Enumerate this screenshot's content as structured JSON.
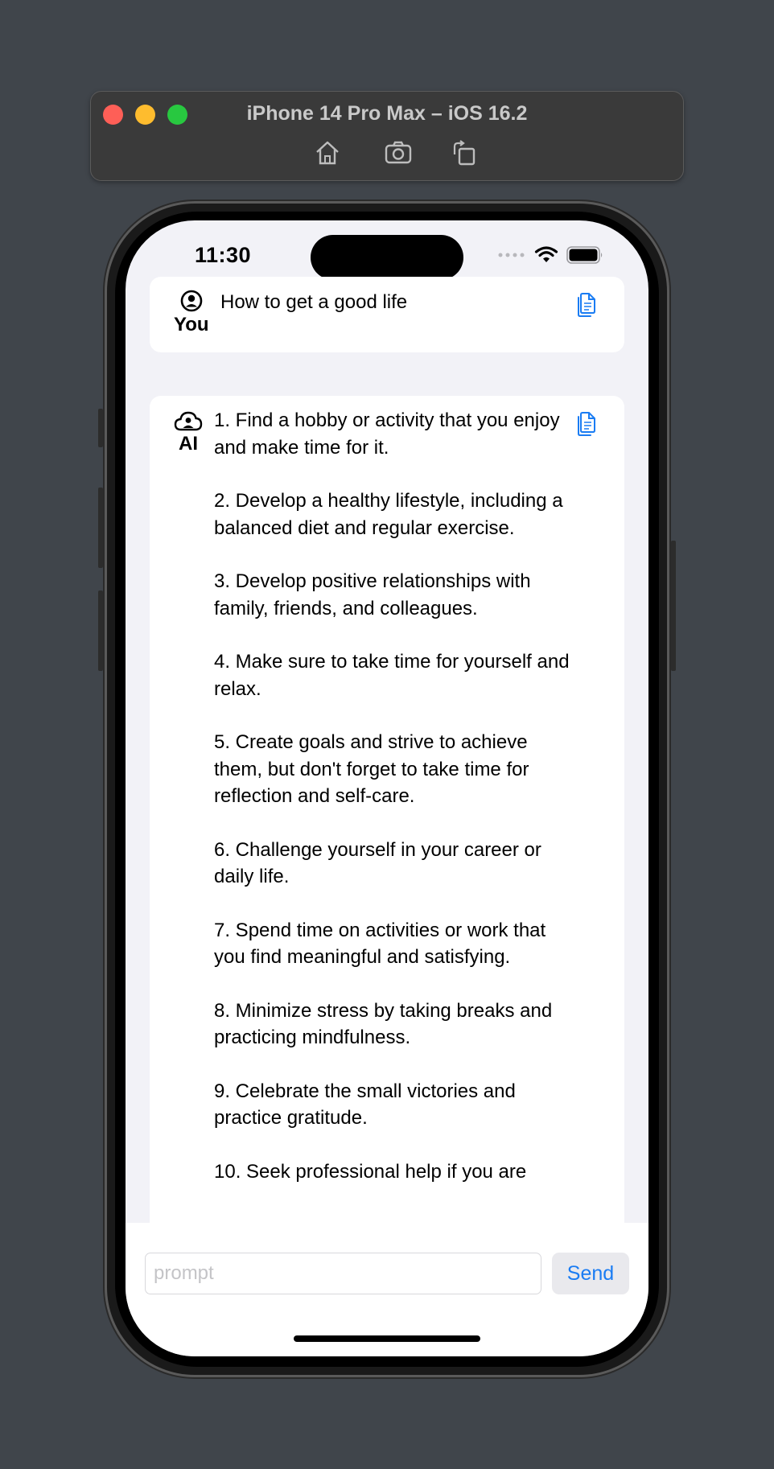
{
  "simulator": {
    "title": "iPhone 14 Pro Max – iOS 16.2"
  },
  "status_bar": {
    "time": "11:30"
  },
  "user_message": {
    "role": "You",
    "text": "How to get a good life"
  },
  "ai_message": {
    "role": "AI",
    "items": [
      "1. Find a hobby or activity that you enjoy and make time for it.",
      "2. Develop a healthy lifestyle, including a balanced diet and regular exercise.",
      "3. Develop positive relationships with family, friends, and colleagues.",
      "4. Make sure to take time for yourself and relax.",
      "5. Create goals and strive to achieve them, but don't forget to take time for reflection and self-care.",
      "6. Challenge yourself in your career or daily life.",
      "7. Spend time on activities or work that you find meaningful and satisfying.",
      "8. Minimize stress by taking breaks and practicing mindfulness.",
      "9. Celebrate the small victories and practice gratitude.",
      "10. Seek professional help if you are"
    ]
  },
  "input": {
    "placeholder": "prompt",
    "value": ""
  },
  "send_button": {
    "label": "Send"
  },
  "colors": {
    "accent": "#1a7cf3",
    "background": "#f2f2f7",
    "desktop": "#40454b"
  }
}
